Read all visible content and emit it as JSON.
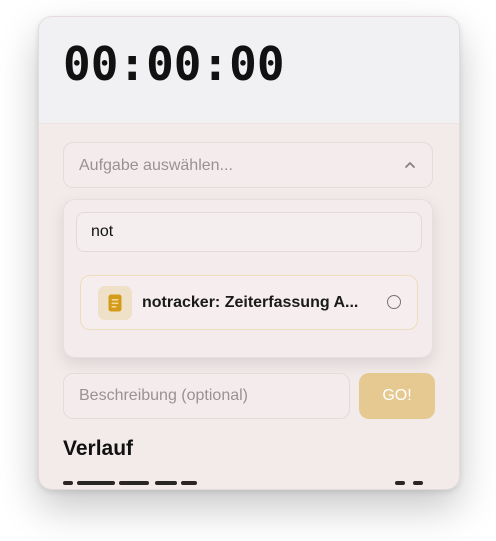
{
  "timer": {
    "display": "00:00:00"
  },
  "task_select": {
    "placeholder": "Aufgabe auswählen...",
    "expanded": true,
    "chevron_icon": "chevron-up-icon"
  },
  "dropdown": {
    "search_value": "not",
    "options": [
      {
        "label": "notracker: Zeiterfassung A...",
        "icon": "document-icon",
        "selected": false
      }
    ]
  },
  "description": {
    "placeholder": "Beschreibung (optional)"
  },
  "go_button": {
    "label": "GO!"
  },
  "history": {
    "title": "Verlauf"
  },
  "colors": {
    "accent": "#e6c891",
    "icon_tile": "#efe0c8",
    "icon_fg": "#d39b17",
    "background": "#f3eaea"
  }
}
